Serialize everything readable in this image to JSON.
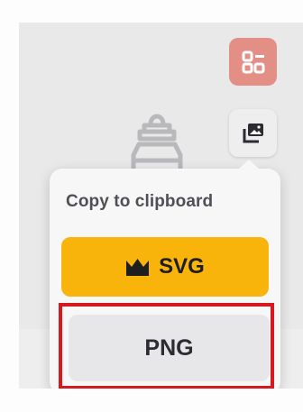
{
  "canvas": {
    "icons": [
      "baby-bottle-icon"
    ]
  },
  "toolbar": {
    "buttons": [
      {
        "icon": "layout-grid-icon",
        "color": "#e38f86"
      },
      {
        "icon": "image-copy-icon",
        "color": "#eeeeef"
      }
    ]
  },
  "popover": {
    "title": "Copy to clipboard",
    "svg_button": {
      "label": "SVG",
      "icon": "crown-icon",
      "color": "#f8b40b"
    },
    "png_button": {
      "label": "PNG",
      "color": "#e7e7e9",
      "highlight_color": "#d5191f"
    }
  }
}
